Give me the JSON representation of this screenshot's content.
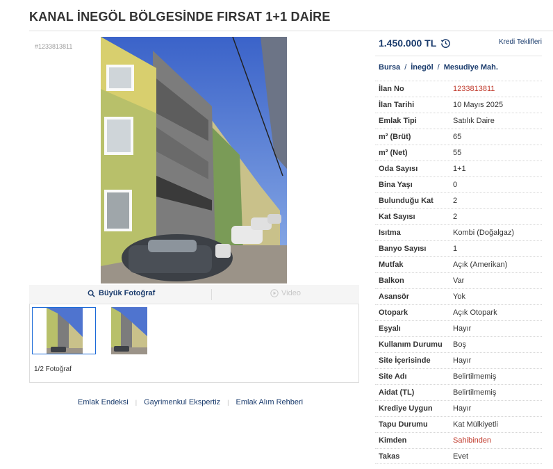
{
  "title": "KANAL İNEGÖL BÖLGESİNDE FIRSAT 1+1 DAİRE",
  "listing_id_label": "#1233813811",
  "photo": {
    "big_photo_label": "Büyük Fotoğraf",
    "video_label": "Video",
    "count_label": "1/2 Fotoğraf"
  },
  "footer_links": [
    "Emlak Endeksi",
    "Gayrimenkul Ekspertiz",
    "Emlak Alım Rehberi"
  ],
  "price": "1.450.000 TL",
  "loan_offers": "Kredi Teklifleri",
  "breadcrumb": [
    "Bursa",
    "İnegöl",
    "Mesudiye Mah."
  ],
  "specs": [
    {
      "key": "İlan No",
      "value": "1233813811",
      "highlight": true
    },
    {
      "key": "İlan Tarihi",
      "value": "10 Mayıs 2025"
    },
    {
      "key": "Emlak Tipi",
      "value": "Satılık Daire"
    },
    {
      "key": "m² (Brüt)",
      "value": "65"
    },
    {
      "key": "m² (Net)",
      "value": "55"
    },
    {
      "key": "Oda Sayısı",
      "value": "1+1"
    },
    {
      "key": "Bina Yaşı",
      "value": "0"
    },
    {
      "key": "Bulunduğu Kat",
      "value": "2"
    },
    {
      "key": "Kat Sayısı",
      "value": "2"
    },
    {
      "key": "Isıtma",
      "value": "Kombi (Doğalgaz)"
    },
    {
      "key": "Banyo Sayısı",
      "value": "1"
    },
    {
      "key": "Mutfak",
      "value": "Açık (Amerikan)"
    },
    {
      "key": "Balkon",
      "value": "Var"
    },
    {
      "key": "Asansör",
      "value": "Yok"
    },
    {
      "key": "Otopark",
      "value": "Açık Otopark"
    },
    {
      "key": "Eşyalı",
      "value": "Hayır"
    },
    {
      "key": "Kullanım Durumu",
      "value": "Boş"
    },
    {
      "key": "Site İçerisinde",
      "value": "Hayır"
    },
    {
      "key": "Site Adı",
      "value": "Belirtilmemiş"
    },
    {
      "key": "Aidat (TL)",
      "value": "Belirtilmemiş"
    },
    {
      "key": "Krediye Uygun",
      "value": "Hayır"
    },
    {
      "key": "Tapu Durumu",
      "value": "Kat Mülkiyetli"
    },
    {
      "key": "Kimden",
      "value": "Sahibinden",
      "highlight": true
    },
    {
      "key": "Takas",
      "value": "Evet"
    }
  ],
  "colors": {
    "brand": "#1b3c6d",
    "highlight": "#c0392b"
  }
}
